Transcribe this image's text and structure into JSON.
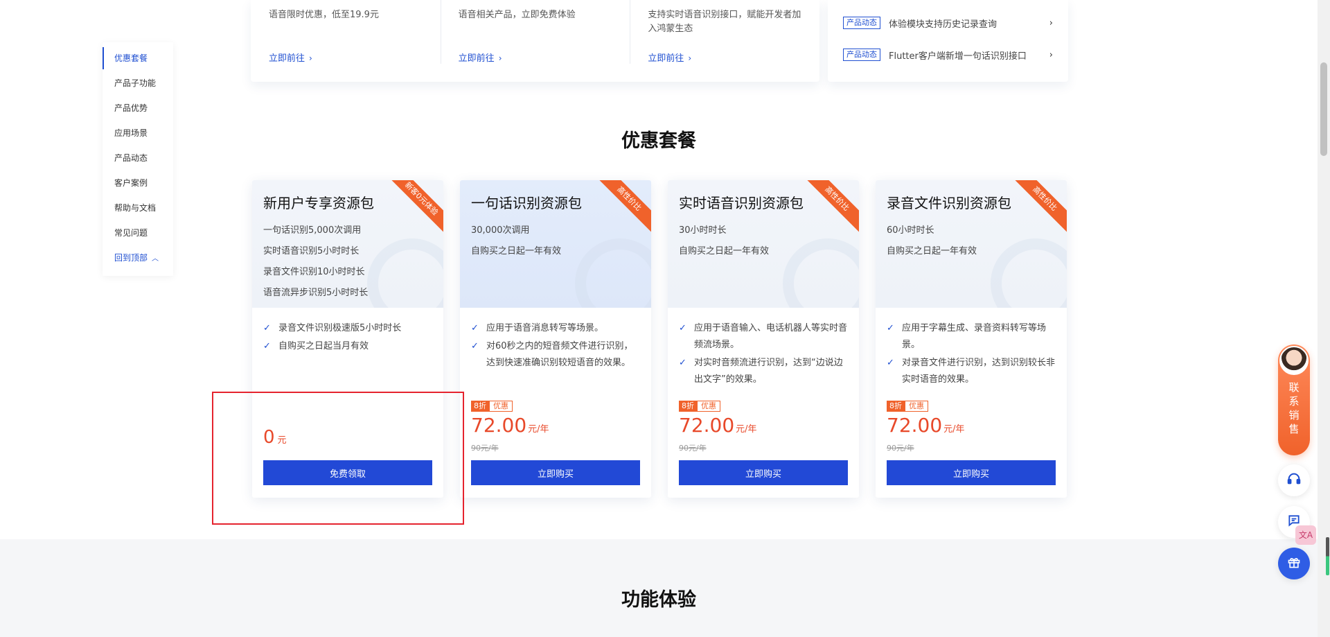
{
  "promo": [
    {
      "desc": "语音限时优惠，低至19.9元",
      "link": "立即前往"
    },
    {
      "desc": "语音相关产品，立即免费体验",
      "link": "立即前往"
    },
    {
      "desc": "支持实时语音识别接口，赋能开发者加入鸿蒙生态",
      "link": "立即前往"
    }
  ],
  "news": [
    {
      "tag": "产品动态",
      "text": "体验模块支持历史记录查询"
    },
    {
      "tag": "产品动态",
      "text": "Flutter客户端新增一句话识别接口"
    }
  ],
  "side_nav": {
    "items": [
      "优惠套餐",
      "产品子功能",
      "产品优势",
      "应用场景",
      "产品动态",
      "客户案例",
      "帮助与文档",
      "常见问题"
    ],
    "back_to_top": "回到顶部"
  },
  "sections": {
    "packages_title": "优惠套餐",
    "experience_title": "功能体验"
  },
  "cards": [
    {
      "title": "新用户专享资源包",
      "ribbon": "新客0元体验",
      "lines": [
        "一句话识别5,000次调用",
        "实时语音识别5小时时长",
        "录音文件识别10小时时长",
        "语音流异步识别5小时时长"
      ],
      "features": [
        "录音文件识别极速版5小时时长",
        "自购买之日起当月有效"
      ],
      "price": "0",
      "unit": "元",
      "button": "免费领取"
    },
    {
      "title": "一句话识别资源包",
      "ribbon": "高性价比",
      "lines": [
        "30,000次调用",
        "自购买之日起一年有效"
      ],
      "features": [
        "应用于语音消息转写等场景。",
        "对60秒之内的短音频文件进行识别，达到快速准确识别较短语音的效果。"
      ],
      "badge_discount": "8折",
      "badge_label": "优惠",
      "price": "72.00",
      "unit": "元/年",
      "old_price": "90元/年",
      "button": "立即购买"
    },
    {
      "title": "实时语音识别资源包",
      "ribbon": "高性价比",
      "lines": [
        "30小时时长",
        "自购买之日起一年有效"
      ],
      "features": [
        "应用于语音输入、电话机器人等实时音频流场景。",
        "对实时音频流进行识别，达到“边说边出文字”的效果。"
      ],
      "badge_discount": "8折",
      "badge_label": "优惠",
      "price": "72.00",
      "unit": "元/年",
      "old_price": "90元/年",
      "button": "立即购买"
    },
    {
      "title": "录音文件识别资源包",
      "ribbon": "高性价比",
      "lines": [
        "60小时时长",
        "自购买之日起一年有效"
      ],
      "features": [
        "应用于字幕生成、录音资料转写等场景。",
        "对录音文件进行识别，达到识别较长非实时语音的效果。"
      ],
      "badge_discount": "8折",
      "badge_label": "优惠",
      "price": "72.00",
      "unit": "元/年",
      "old_price": "90元/年",
      "button": "立即购买"
    }
  ],
  "float": {
    "contact_chars": [
      "联",
      "系",
      "销",
      "售"
    ],
    "icons": [
      "headset-icon",
      "chat-icon",
      "gift-icon"
    ],
    "translate": "文A"
  },
  "colors": {
    "brand_blue": "#2249d6",
    "accent_orange": "#f0622b",
    "price_red": "#e8492a"
  }
}
